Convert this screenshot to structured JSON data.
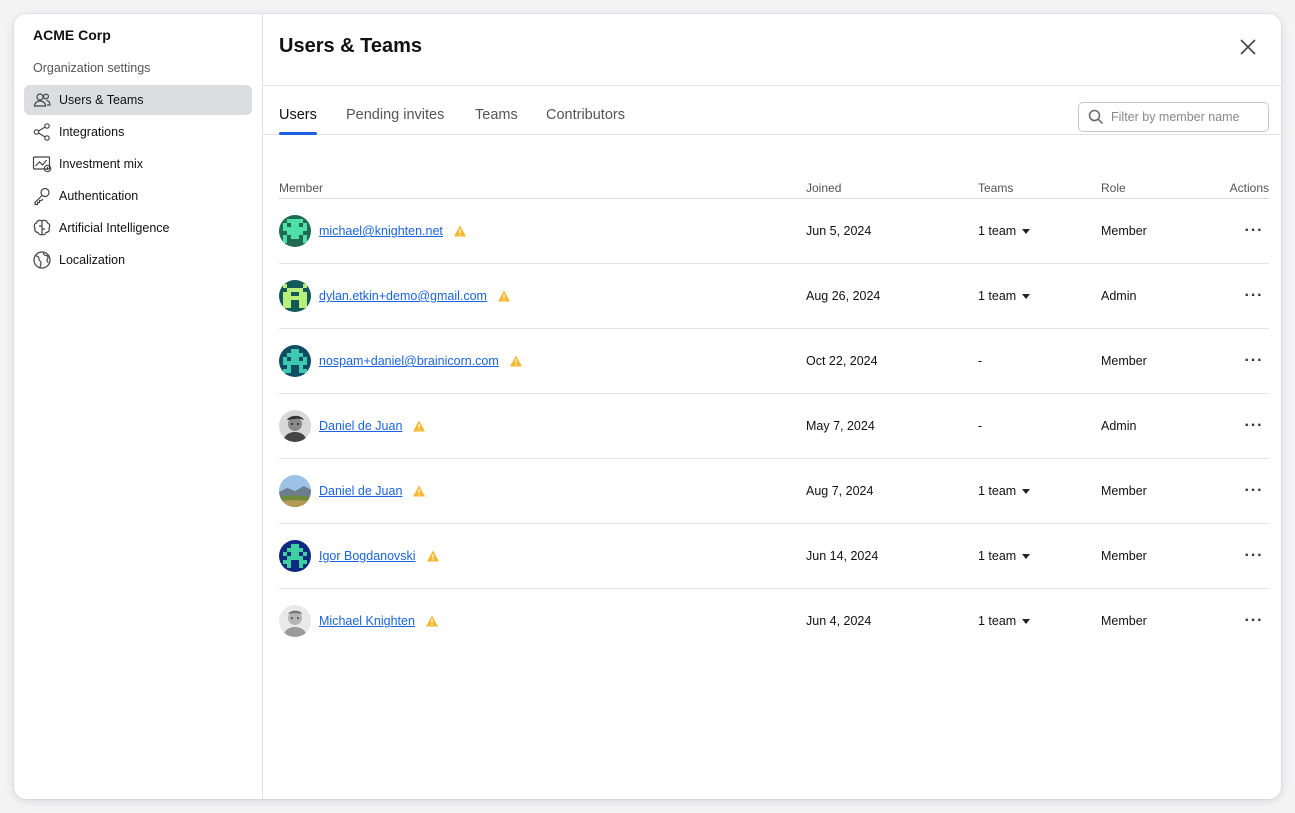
{
  "sidebar": {
    "org_name": "ACME Corp",
    "section_label": "Organization settings",
    "items": [
      {
        "label": "Users & Teams",
        "icon": "users-icon",
        "active": true
      },
      {
        "label": "Integrations",
        "icon": "integrations-icon"
      },
      {
        "label": "Investment mix",
        "icon": "investment-mix-icon"
      },
      {
        "label": "Authentication",
        "icon": "key-icon"
      },
      {
        "label": "Artificial Intelligence",
        "icon": "brain-icon"
      },
      {
        "label": "Localization",
        "icon": "globe-icon"
      }
    ]
  },
  "header": {
    "title": "Users & Teams",
    "close_icon": "close-icon"
  },
  "tabs": [
    {
      "label": "Users",
      "active": true
    },
    {
      "label": "Pending invites"
    },
    {
      "label": "Teams"
    },
    {
      "label": "Contributors"
    }
  ],
  "filter": {
    "placeholder": "Filter by member name",
    "value": ""
  },
  "table": {
    "headers": {
      "member": "Member",
      "joined": "Joined",
      "teams": "Teams",
      "role": "Role",
      "actions": "Actions"
    },
    "rows": [
      {
        "member": "michael@knighten.net",
        "joined": "Jun 5, 2024",
        "teams": "1 team",
        "role": "Member",
        "avatar": "pixel-green"
      },
      {
        "member": "dylan.etkin+demo@gmail.com",
        "joined": "Aug 26, 2024",
        "teams": "1 team",
        "role": "Admin",
        "avatar": "pixel-teal"
      },
      {
        "member": "nospam+daniel@brainicorn.com",
        "joined": "Oct 22, 2024",
        "teams": "-",
        "role": "Member",
        "avatar": "pixel-cyan"
      },
      {
        "member": "Daniel de Juan",
        "joined": "May 7, 2024",
        "teams": "-",
        "role": "Admin",
        "avatar": "photo-bw"
      },
      {
        "member": "Daniel de Juan",
        "joined": "Aug 7, 2024",
        "teams": "1 team",
        "role": "Member",
        "avatar": "photo-landscape"
      },
      {
        "member": "Igor Bogdanovski",
        "joined": "Jun 14, 2024",
        "teams": "1 team",
        "role": "Member",
        "avatar": "pixel-navy"
      },
      {
        "member": "Michael Knighten",
        "joined": "Jun 4, 2024",
        "teams": "1 team",
        "role": "Member",
        "avatar": "photo-gray"
      }
    ],
    "actions_label": "···"
  },
  "colors": {
    "accent": "#1a63e0",
    "warning": "#f5b82e",
    "active_nav_bg": "#dcdde0"
  }
}
